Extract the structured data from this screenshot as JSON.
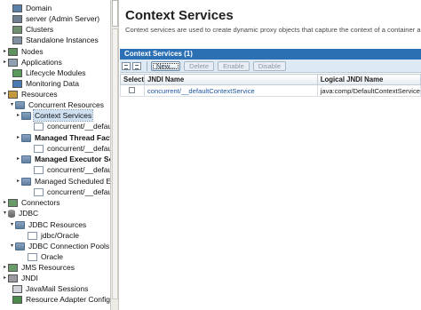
{
  "nav": {
    "items": [
      {
        "label": "Domain",
        "icon": "domain-icon",
        "twisty": "",
        "bold": false,
        "selected": false
      },
      {
        "label": "server (Admin Server)",
        "icon": "server-icon",
        "twisty": "",
        "bold": false,
        "selected": false
      },
      {
        "label": "Clusters",
        "icon": "cluster-icon",
        "twisty": "",
        "bold": false,
        "selected": false
      },
      {
        "label": "Standalone Instances",
        "icon": "instance-icon",
        "twisty": "",
        "bold": false,
        "selected": false
      },
      {
        "label": "Nodes",
        "icon": "nodes-icon",
        "twisty": "▸",
        "bold": false,
        "selected": false
      },
      {
        "label": "Applications",
        "icon": "applications-icon",
        "twisty": "▸",
        "bold": false,
        "selected": false
      },
      {
        "label": "Lifecycle Modules",
        "icon": "lifecycle-icon",
        "twisty": "",
        "bold": false,
        "selected": false
      },
      {
        "label": "Monitoring Data",
        "icon": "monitoring-icon",
        "twisty": "",
        "bold": false,
        "selected": false
      },
      {
        "label": "Resources",
        "icon": "resources-icon",
        "twisty": "▾",
        "bold": false,
        "selected": false
      },
      {
        "label": "Concurrent Resources",
        "icon": "folder-icon",
        "twisty": "▾",
        "bold": false,
        "selected": false
      },
      {
        "label": "Context Services",
        "icon": "folder-icon",
        "twisty": "▸",
        "bold": false,
        "selected": true
      },
      {
        "label": "concurrent/__defaultCon",
        "icon": "resource-icon",
        "twisty": "",
        "bold": false,
        "selected": false
      },
      {
        "label": "Managed Thread Factor",
        "icon": "folder-icon",
        "twisty": "▸",
        "bold": true,
        "selected": false
      },
      {
        "label": "concurrent/__defaultMan",
        "icon": "resource-icon",
        "twisty": "",
        "bold": false,
        "selected": false
      },
      {
        "label": "Managed Executor Servi",
        "icon": "folder-icon",
        "twisty": "▸",
        "bold": true,
        "selected": false
      },
      {
        "label": "concurrent/__defaultMan",
        "icon": "resource-icon",
        "twisty": "",
        "bold": false,
        "selected": false
      },
      {
        "label": "Managed Scheduled Exec",
        "icon": "folder-icon",
        "twisty": "▸",
        "bold": false,
        "selected": false
      },
      {
        "label": "concurrent/__defaultMan",
        "icon": "resource-icon",
        "twisty": "",
        "bold": false,
        "selected": false
      },
      {
        "label": "Connectors",
        "icon": "connectors-icon",
        "twisty": "▸",
        "bold": false,
        "selected": false
      },
      {
        "label": "JDBC",
        "icon": "jdbc-icon",
        "twisty": "▾",
        "bold": false,
        "selected": false
      },
      {
        "label": "JDBC Resources",
        "icon": "folder-icon",
        "twisty": "▾",
        "bold": false,
        "selected": false
      },
      {
        "label": "jdbc/Oracle",
        "icon": "resource-icon",
        "twisty": "",
        "bold": false,
        "selected": false
      },
      {
        "label": "JDBC Connection Pools",
        "icon": "folder-icon",
        "twisty": "▾",
        "bold": false,
        "selected": false
      },
      {
        "label": "Oracle",
        "icon": "resource-icon",
        "twisty": "",
        "bold": false,
        "selected": false
      },
      {
        "label": "JMS Resources",
        "icon": "jms-icon",
        "twisty": "▸",
        "bold": false,
        "selected": false
      },
      {
        "label": "JNDI",
        "icon": "jndi-icon",
        "twisty": "▸",
        "bold": false,
        "selected": false
      },
      {
        "label": "JavaMail Sessions",
        "icon": "mail-icon",
        "twisty": "",
        "bold": false,
        "selected": false
      },
      {
        "label": "Resource Adapter Configs",
        "icon": "adapter-icon",
        "twisty": "",
        "bold": false,
        "selected": false
      }
    ]
  },
  "main": {
    "title": "Context Services",
    "description": "Context services are used to create dynamic proxy objects that capture the context of a container and en",
    "table": {
      "caption": "Context Services (1)",
      "toolbar": {
        "new": "New...",
        "delete": "Delete",
        "enable": "Enable",
        "disable": "Disable"
      },
      "columns": [
        "Select",
        "JNDI Name",
        "Logical JNDI Name"
      ],
      "rows": [
        {
          "jndi_name": "concurrent/__defaultContextService",
          "logical_jndi_name": "java:comp/DefaultContextService"
        }
      ]
    }
  },
  "colors": {
    "caption_bar": "#2b6fb4",
    "toolbar_bg": "#dde9f4",
    "link": "#1f57a3",
    "selection": "#cfe0f2"
  }
}
